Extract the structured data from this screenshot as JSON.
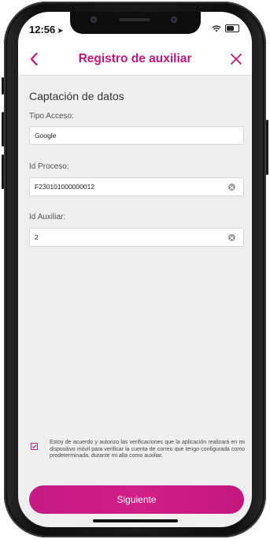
{
  "status_bar": {
    "time": "12:56",
    "location_glyph": "➤"
  },
  "header": {
    "title": "Registro de auxiliar",
    "back_icon": "chevron-left",
    "close_icon": "x"
  },
  "form": {
    "section_title": "Captación de datos",
    "fields": [
      {
        "label": "Tipo Acceso:",
        "value": "Google"
      },
      {
        "label": "Id Proceso:",
        "value": "F230101000000012"
      },
      {
        "label": "Id Auxiliar:",
        "value": "2"
      }
    ]
  },
  "consent": {
    "checked": true,
    "text": "Estoy de acuerdo y autorizo las verificaciones que la aplicación realizará en mi dispositivo móvil para verificar la cuenta de correo que tengo configurada como predeterminada, durante mi alta como auxiliar."
  },
  "actions": {
    "next_label": "Siguiente"
  },
  "colors": {
    "accent": "#c4177d",
    "background": "#efefef"
  }
}
